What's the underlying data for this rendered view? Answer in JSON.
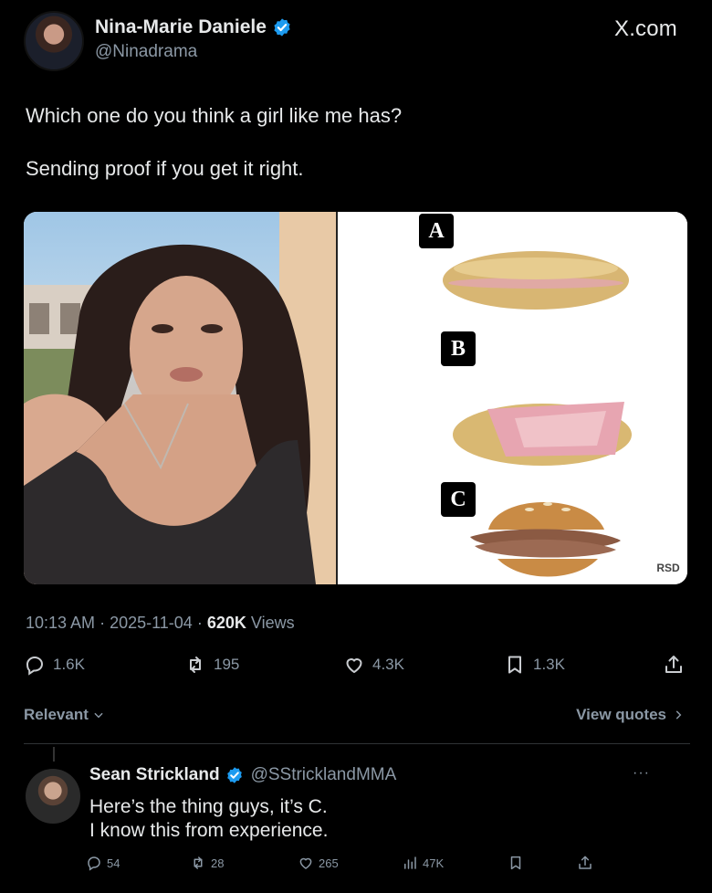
{
  "author": {
    "display_name": "Nina-Marie Daniele",
    "handle": "@Ninadrama",
    "verified": true
  },
  "site_label": "X.com",
  "tweet": {
    "line1": "Which one do you think a girl like me has?",
    "line2": "Sending proof if you get it right."
  },
  "media": {
    "options": [
      "A",
      "B",
      "C"
    ],
    "watermark": "RSD"
  },
  "meta": {
    "time": "10:13 AM",
    "date": "2025-11-04",
    "views_count": "620K",
    "views_label": "Views"
  },
  "actions": {
    "replies": "1.6K",
    "reposts": "195",
    "likes": "4.3K",
    "bookmarks": "1.3K"
  },
  "sort": {
    "label": "Relevant",
    "view_quotes": "View quotes"
  },
  "reply": {
    "display_name": "Sean Strickland",
    "handle": "@SStricklandMMA",
    "verified": true,
    "line1": "Here’s the thing guys, it’s C.",
    "line2": "I know this from experience.",
    "replies": "54",
    "reposts": "28",
    "likes": "265",
    "views": "47K"
  },
  "colors": {
    "background": "#000000",
    "text": "#e7e9ea",
    "muted": "#8b98a5",
    "verified_blue": "#1d9bf0"
  }
}
